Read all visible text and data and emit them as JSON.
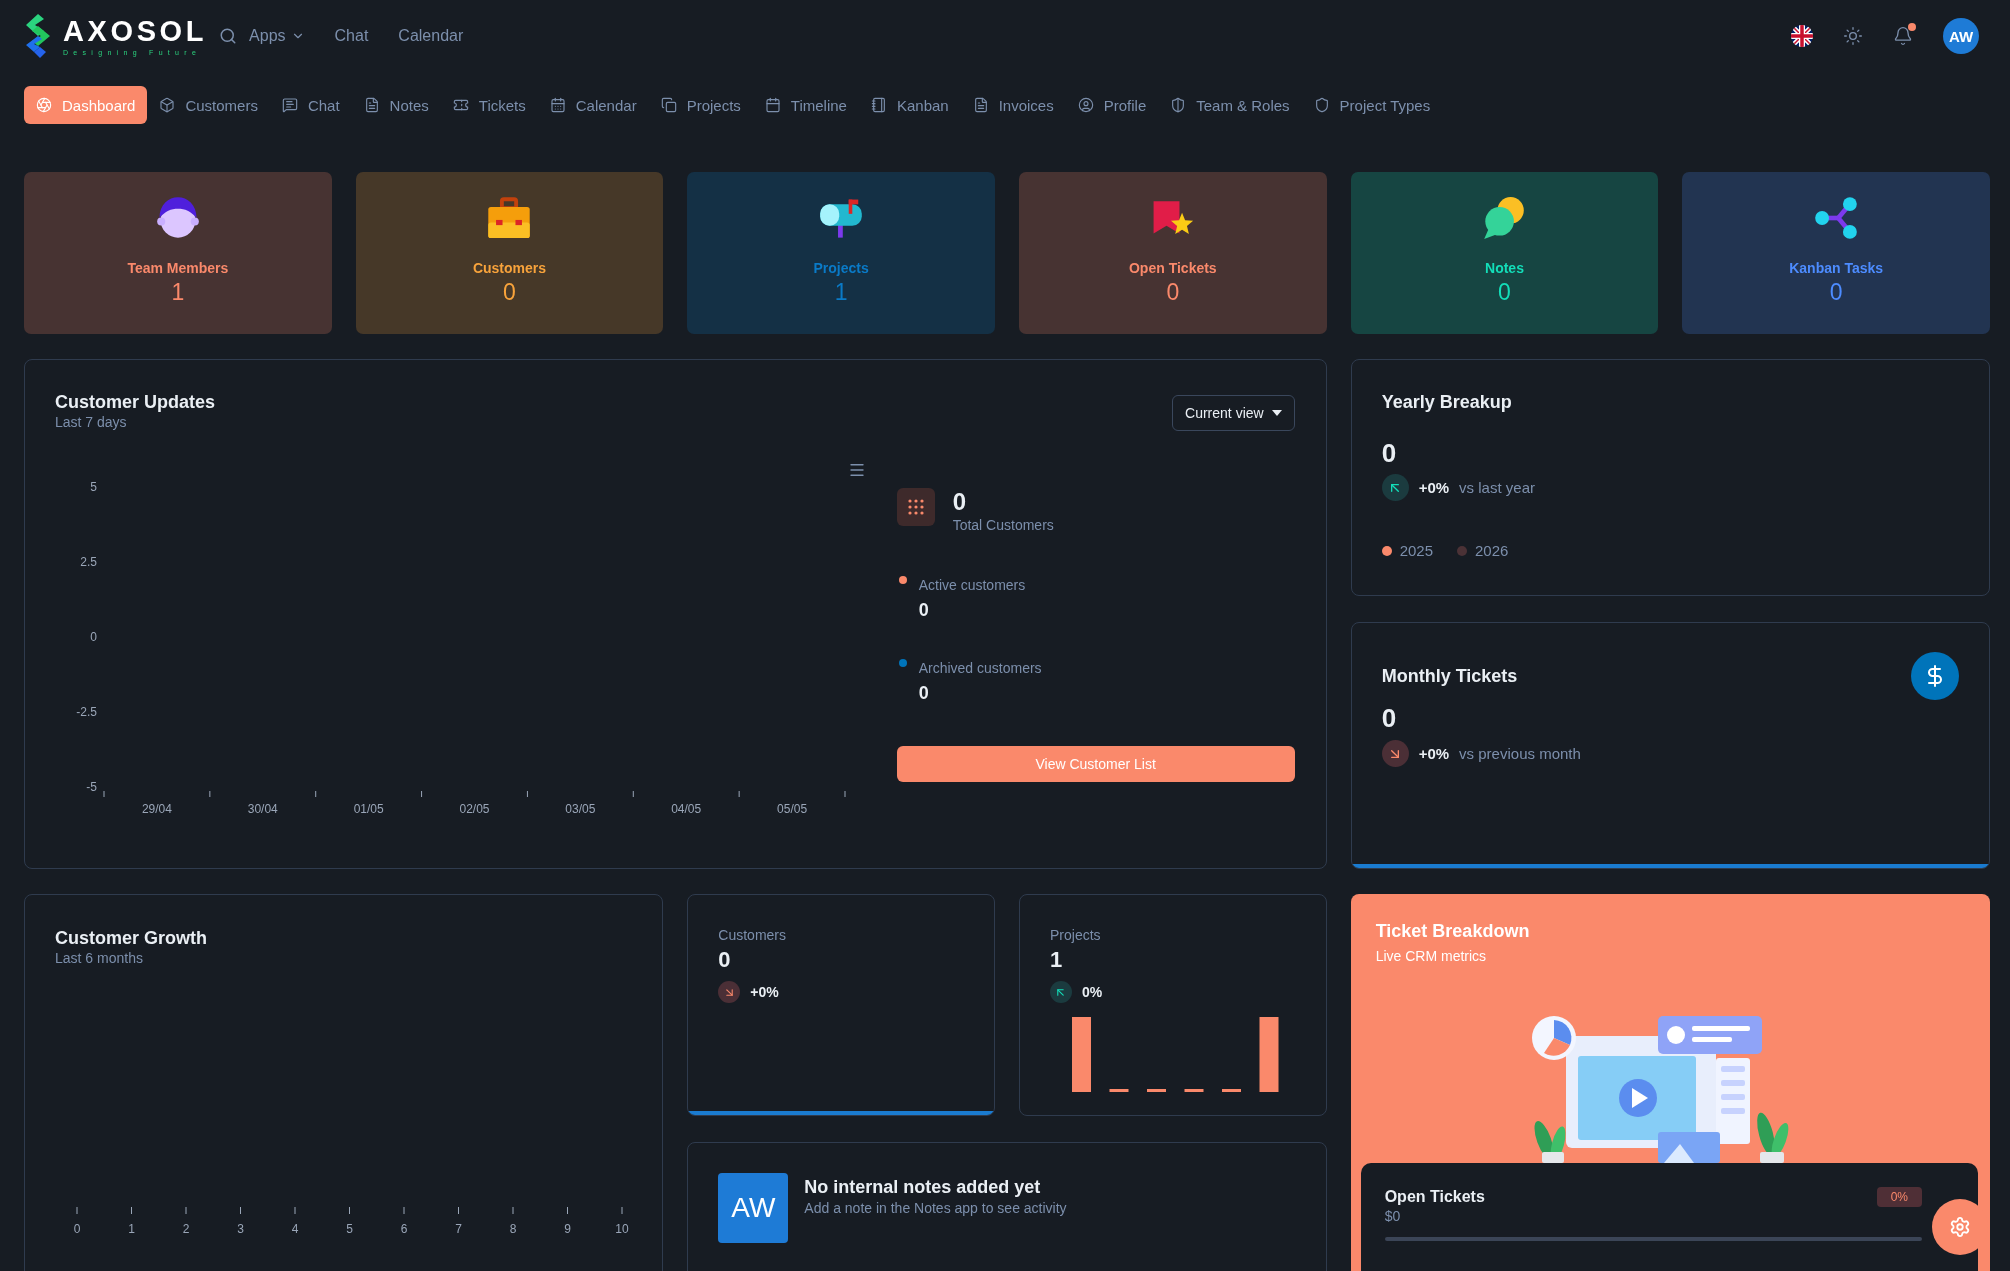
{
  "header": {
    "logo": {
      "name": "AXOSOL",
      "tagline": "Designing Future"
    },
    "top_links": [
      {
        "label": "Apps",
        "dropdown": true
      },
      {
        "label": "Chat",
        "dropdown": false
      },
      {
        "label": "Calendar",
        "dropdown": false
      }
    ],
    "notification_unread": true,
    "avatar": "AW"
  },
  "nav": [
    {
      "label": "Dashboard",
      "selected": true
    },
    {
      "label": "Customers",
      "selected": false
    },
    {
      "label": "Chat",
      "selected": false
    },
    {
      "label": "Notes",
      "selected": false
    },
    {
      "label": "Tickets",
      "selected": false
    },
    {
      "label": "Calendar",
      "selected": false
    },
    {
      "label": "Projects",
      "selected": false
    },
    {
      "label": "Timeline",
      "selected": false
    },
    {
      "label": "Kanban",
      "selected": false
    },
    {
      "label": "Invoices",
      "selected": false
    },
    {
      "label": "Profile",
      "selected": false
    },
    {
      "label": "Team & Roles",
      "selected": false
    },
    {
      "label": "Project Types",
      "selected": false
    }
  ],
  "stats": [
    {
      "label": "Team Members",
      "value": "1",
      "color": "#fa896b"
    },
    {
      "label": "Customers",
      "value": "0",
      "color": "#f8a33b"
    },
    {
      "label": "Projects",
      "value": "1",
      "color": "#0a7ac7"
    },
    {
      "label": "Open Tickets",
      "value": "0",
      "color": "#fa896b"
    },
    {
      "label": "Notes",
      "value": "0",
      "color": "#13deb9"
    },
    {
      "label": "Kanban Tasks",
      "value": "0",
      "color": "#4d8cff"
    }
  ],
  "customer_updates": {
    "title": "Customer Updates",
    "subtitle": "Last 7 days",
    "view_button": "Current view",
    "chart_data": {
      "type": "bar",
      "categories": [
        "29/04",
        "30/04",
        "01/05",
        "02/05",
        "03/05",
        "04/05",
        "05/05"
      ],
      "yticks": [
        -5,
        -2.5,
        0,
        2.5,
        5
      ],
      "ylim": [
        -5,
        5
      ]
    },
    "summary": {
      "total": "0",
      "total_label": "Total Customers",
      "legend": [
        {
          "label": "Active customers",
          "value": "0",
          "color": "#fa896b"
        },
        {
          "label": "Archived customers",
          "value": "0",
          "color": "#0074ba"
        }
      ],
      "button": "View Customer List"
    }
  },
  "yearly_breakup": {
    "title": "Yearly Breakup",
    "value": "0",
    "change": "+0%",
    "rising": true,
    "comparison": "vs last year",
    "legend": [
      {
        "label": "2025",
        "color": "#fa896b"
      },
      {
        "label": "2026",
        "color": "#4b3236"
      }
    ]
  },
  "monthly_tickets": {
    "title": "Monthly Tickets",
    "value": "0",
    "change": "+0%",
    "rising": false,
    "comparison": "vs previous month"
  },
  "customer_growth": {
    "title": "Customer Growth",
    "subtitle": "Last 6 months",
    "axis_labels": [
      "0",
      "1",
      "2",
      "3",
      "4",
      "5",
      "6",
      "7",
      "8",
      "9",
      "10"
    ]
  },
  "mini_stats": [
    {
      "label": "Customers",
      "value": "0",
      "change": "+0%",
      "rising": false,
      "kind": "sparkline"
    },
    {
      "label": "Projects",
      "value": "1",
      "change": "0%",
      "rising": true,
      "kind": "bars"
    }
  ],
  "notes": {
    "avatar": "AW",
    "title": "No internal notes added yet",
    "message": "Add a note in the Notes app to see activity"
  },
  "ticket_breakdown": {
    "title": "Ticket Breakdown",
    "subtitle": "Live CRM metrics",
    "items": [
      {
        "label": "Open Tickets",
        "amount": "$0",
        "percent": "0%",
        "level": 0
      }
    ]
  }
}
